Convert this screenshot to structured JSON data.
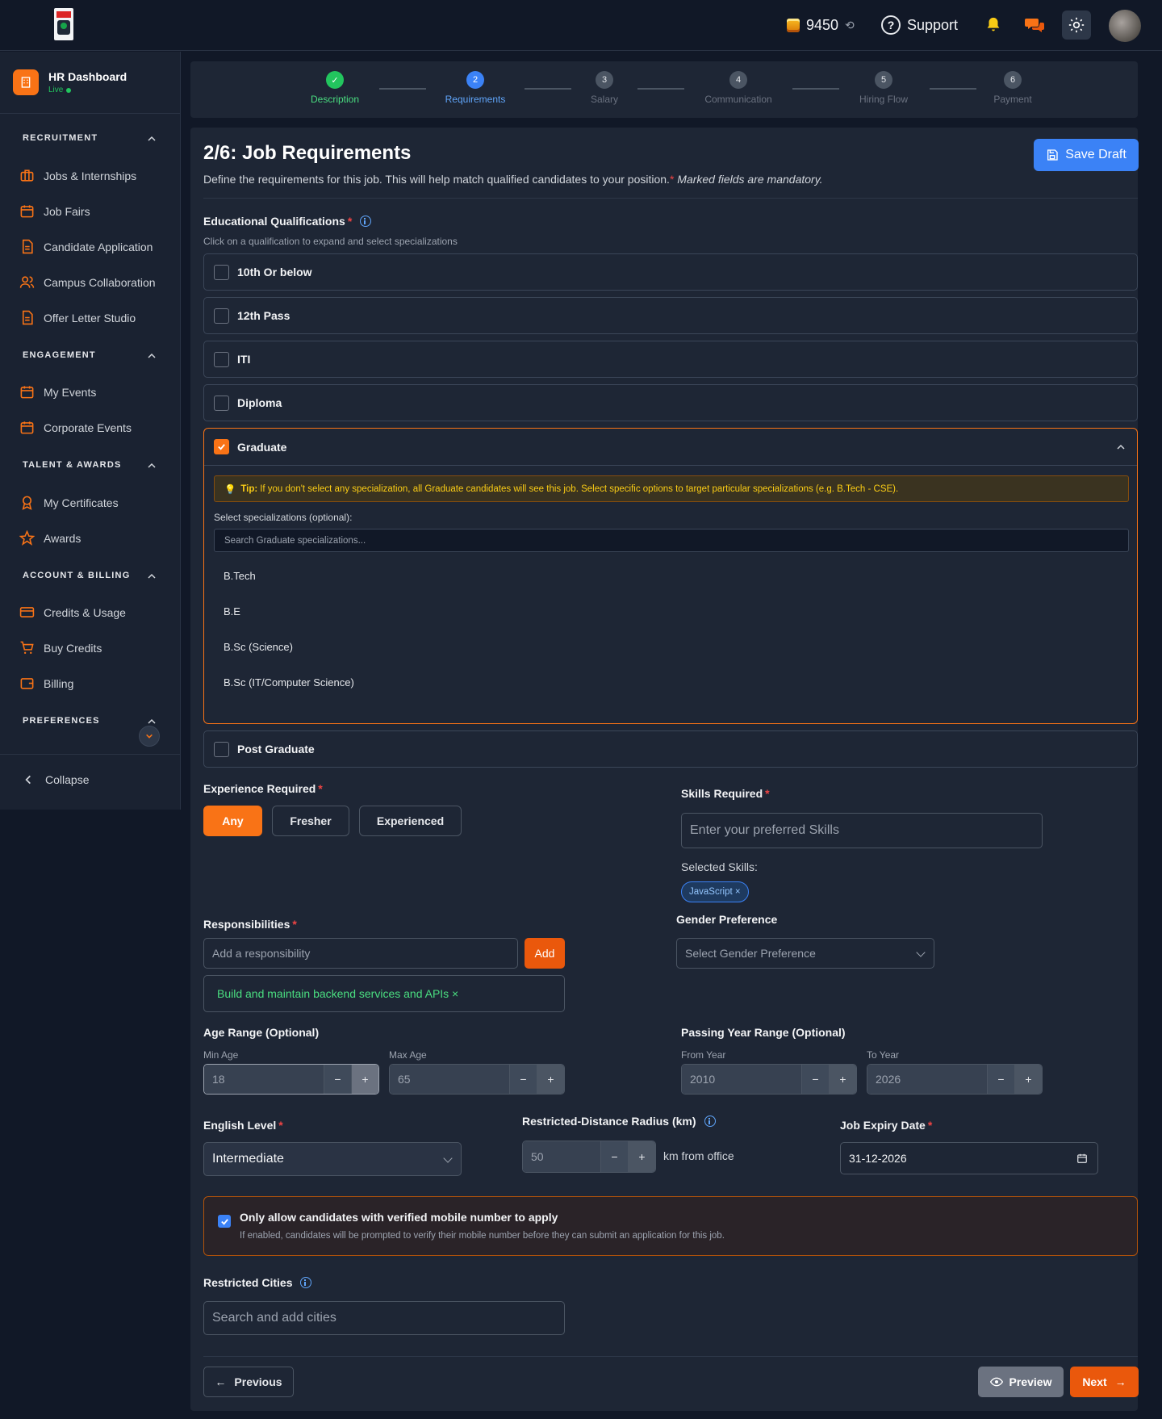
{
  "header": {
    "credits": "9450",
    "history_icon": "history-icon",
    "support_label": "Support",
    "icons": [
      "coins-icon",
      "help-circle-icon",
      "bell-icon",
      "chat-icon",
      "sun-icon",
      "avatar"
    ]
  },
  "sidebar": {
    "brand_title": "HR Dashboard",
    "brand_status": "Live",
    "sections": {
      "recruitment": "RECRUITMENT",
      "engagement": "ENGAGEMENT",
      "talent": "TALENT & AWARDS",
      "account": "ACCOUNT & BILLING",
      "preferences": "PREFERENCES"
    },
    "items": {
      "jobs": "Jobs & Internships",
      "fairs": "Job Fairs",
      "candidate": "Candidate Application",
      "campus": "Campus Collaboration",
      "offer": "Offer Letter Studio",
      "events": "My Events",
      "corporate": "Corporate Events",
      "certs": "My Certificates",
      "awards": "Awards",
      "credits": "Credits & Usage",
      "buy": "Buy Credits",
      "billing": "Billing"
    },
    "collapse_label": "Collapse"
  },
  "stepper": {
    "steps": [
      {
        "num": "✓",
        "label": "Description",
        "state": "done"
      },
      {
        "num": "2",
        "label": "Requirements",
        "state": "active"
      },
      {
        "num": "3",
        "label": "Salary",
        "state": "pending"
      },
      {
        "num": "4",
        "label": "Communication",
        "state": "pending"
      },
      {
        "num": "5",
        "label": "Hiring Flow",
        "state": "pending"
      },
      {
        "num": "6",
        "label": "Payment",
        "state": "pending"
      }
    ]
  },
  "form": {
    "title": "2/6: Job Requirements",
    "subtitle": "Define the requirements for this job. This will help match qualified candidates to your position.",
    "mandatory_note": "Marked fields are mandatory.",
    "save_draft": "Save Draft",
    "edu_label": "Educational Qualifications",
    "edu_hint": "Click on a qualification to expand and select specializations",
    "qualifications": {
      "q1": "10th Or below",
      "q2": "12th Pass",
      "q3": "ITI",
      "q4": "Diploma",
      "q5": "Graduate",
      "q6": "Post Graduate"
    },
    "tip_label": "Tip:",
    "tip_text": "If you don't select any specialization, all Graduate candidates will see this job. Select specific options to target particular specializations (e.g. B.Tech - CSE).",
    "spec_label": "Select specializations (optional):",
    "spec_placeholder": "Search Graduate specializations...",
    "specializations": {
      "s1": "B.Tech",
      "s2": "B.E",
      "s3": "B.Sc (Science)",
      "s4": "B.Sc (IT/Computer Science)"
    },
    "experience_label": "Experience Required",
    "experience_options": {
      "any": "Any",
      "fresher": "Fresher",
      "experienced": "Experienced"
    },
    "skills_label": "Skills Required",
    "skills_placeholder": "Enter your preferred Skills",
    "selected_skills_label": "Selected Skills:",
    "selected_skill": "JavaScript ×",
    "responsibilities_label": "Responsibilities",
    "responsibility_placeholder": "Add a responsibility",
    "add_label": "Add",
    "responsibility_item": "Build and maintain backend services and APIs ×",
    "gender_label": "Gender Preference",
    "gender_placeholder": "Select Gender Preference",
    "age_label": "Age Range (Optional)",
    "min_age_label": "Min Age",
    "min_age": "18",
    "max_age_label": "Max Age",
    "max_age": "65",
    "passing_label": "Passing Year Range (Optional)",
    "from_year_label": "From Year",
    "from_year": "2010",
    "to_year_label": "To Year",
    "to_year": "2026",
    "english_label": "English Level",
    "english_value": "Intermediate",
    "radius_label": "Restricted-Distance Radius (km)",
    "radius_value": "50",
    "radius_suffix": "km from office",
    "expiry_label": "Job Expiry Date",
    "expiry_value": "31-12-2026",
    "verify_title": "Only allow candidates with verified mobile number to apply",
    "verify_desc": "If enabled, candidates will be prompted to verify their mobile number before they can submit an application for this job.",
    "cities_label": "Restricted Cities",
    "cities_placeholder": "Search and add cities",
    "previous": "Previous",
    "preview": "Preview",
    "next": "Next",
    "minus": "−",
    "plus": "+"
  },
  "colors": {
    "accent": "#f97316",
    "primary": "#3b82f6",
    "success": "#22c55e"
  }
}
